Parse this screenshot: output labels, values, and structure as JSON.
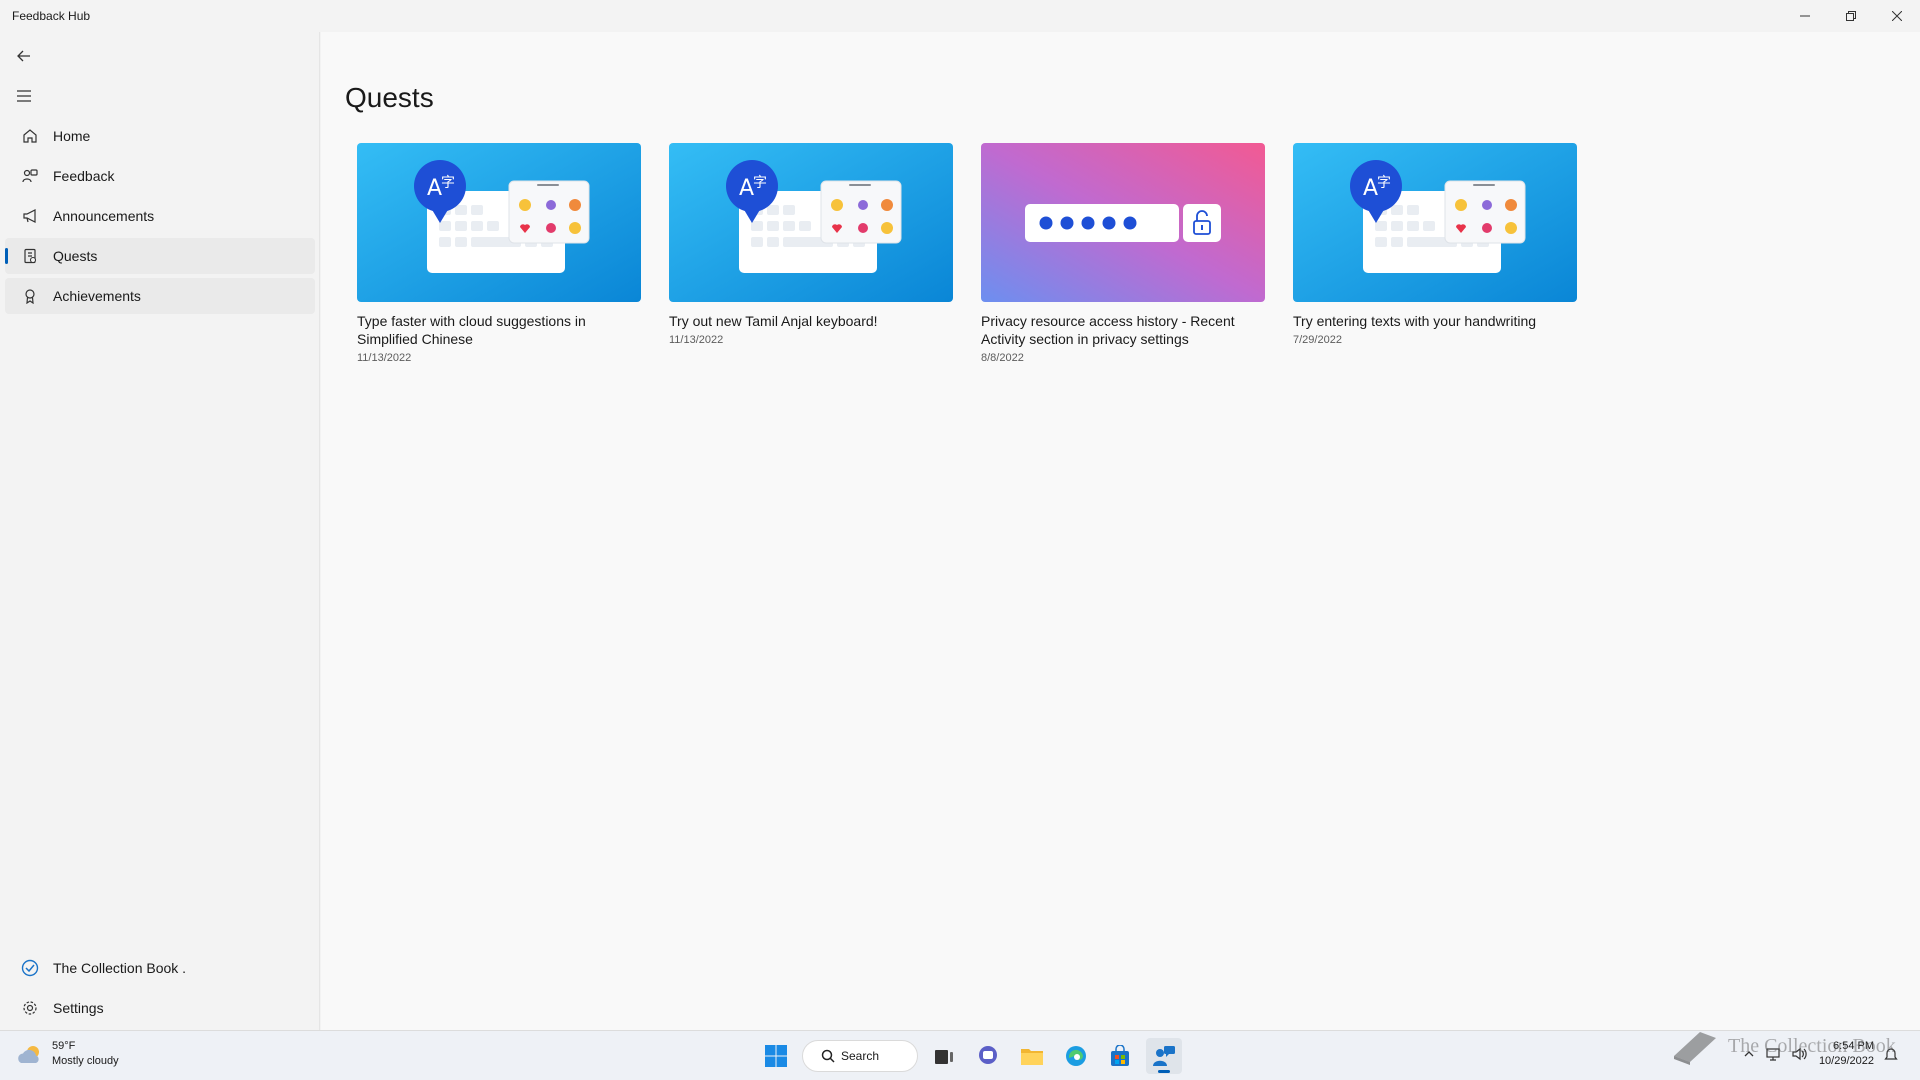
{
  "app": {
    "title": "Feedback Hub"
  },
  "sidebar": {
    "items": [
      {
        "label": "Home",
        "icon": "home-icon"
      },
      {
        "label": "Feedback",
        "icon": "feedback-icon"
      },
      {
        "label": "Announcements",
        "icon": "megaphone-icon"
      },
      {
        "label": "Quests",
        "icon": "quests-icon",
        "selected": true
      },
      {
        "label": "Achievements",
        "icon": "ribbon-icon"
      }
    ],
    "account": {
      "label": "The Collection Book ."
    },
    "settings": {
      "label": "Settings"
    }
  },
  "main": {
    "title": "Quests",
    "cards": [
      {
        "title": "Type faster with cloud suggestions in Simplified Chinese",
        "date": "11/13/2022",
        "image": "keyboard-emoji-illustration"
      },
      {
        "title": "Try out new Tamil Anjal keyboard!",
        "date": "11/13/2022",
        "image": "keyboard-emoji-illustration"
      },
      {
        "title": "Privacy resource access history - Recent Activity section in privacy settings",
        "date": "8/8/2022",
        "image": "password-lock-illustration"
      },
      {
        "title": "Try entering texts with your handwriting",
        "date": "7/29/2022",
        "image": "keyboard-emoji-illustration"
      }
    ]
  },
  "taskbar": {
    "weather": {
      "temp": "59°F",
      "condition": "Mostly cloudy"
    },
    "search_label": "Search",
    "clock": {
      "time": "6:54 PM",
      "date": "10/29/2022"
    },
    "watermark": "The Collection Book"
  },
  "colors": {
    "accent": "#005fb8",
    "card_blue": "#1aa7ec",
    "card_pink": "#e8609a"
  }
}
